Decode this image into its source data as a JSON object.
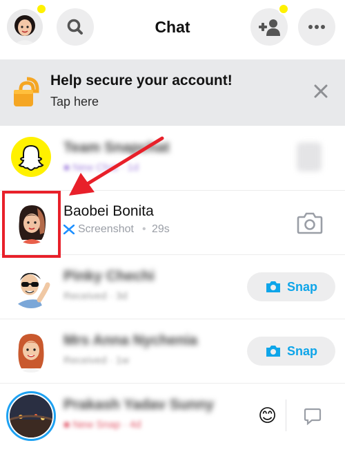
{
  "header": {
    "title": "Chat",
    "colors": {
      "notification_dot": "#fff100",
      "button_bg": "#ededee"
    }
  },
  "banner": {
    "title": "Help secure your account!",
    "subtitle": "Tap here",
    "icon": "lock-icon"
  },
  "chats": [
    {
      "name": "",
      "status": "",
      "time": "",
      "action": "chat-icon"
    },
    {
      "name": "Baobei Bonita",
      "status": "Screenshot",
      "separator": "•",
      "time": "29s",
      "action": "camera-icon"
    },
    {
      "name": "",
      "status": "",
      "action": "Snap"
    },
    {
      "name": "",
      "status": "",
      "action": "Snap"
    },
    {
      "name": "",
      "status": "",
      "time": "",
      "action": "chat-icon",
      "emoji": "😊"
    }
  ],
  "annotation": {
    "color": "#e8202a"
  }
}
